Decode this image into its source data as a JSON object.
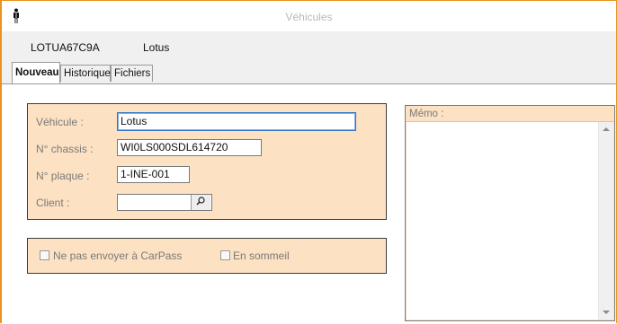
{
  "window": {
    "title": "Véhicules"
  },
  "info": {
    "code": "LOTUA67C9A",
    "make": "Lotus"
  },
  "tabs": [
    {
      "label": "Nouveau",
      "active": true
    },
    {
      "label": "Historique",
      "active": false
    },
    {
      "label": "Fichiers",
      "active": false
    }
  ],
  "form": {
    "vehicule_label": "Véhicule :",
    "vehicule_value": "Lotus",
    "chassis_label": "N° chassis :",
    "chassis_value": "WI0LS000SDL614720",
    "plaque_label": "N° plaque :",
    "plaque_value": "1-INE-001",
    "client_label": "Client :",
    "client_value": ""
  },
  "options": {
    "carpass_label": "Ne pas envoyer à CarPass",
    "carpass_checked": false,
    "sommeil_label": "En sommeil",
    "sommeil_checked": false
  },
  "memo": {
    "label": "Mémo :",
    "value": ""
  },
  "colors": {
    "accent": "#e8931d",
    "panel": "#fce1c3",
    "focus": "#2f74c8"
  }
}
